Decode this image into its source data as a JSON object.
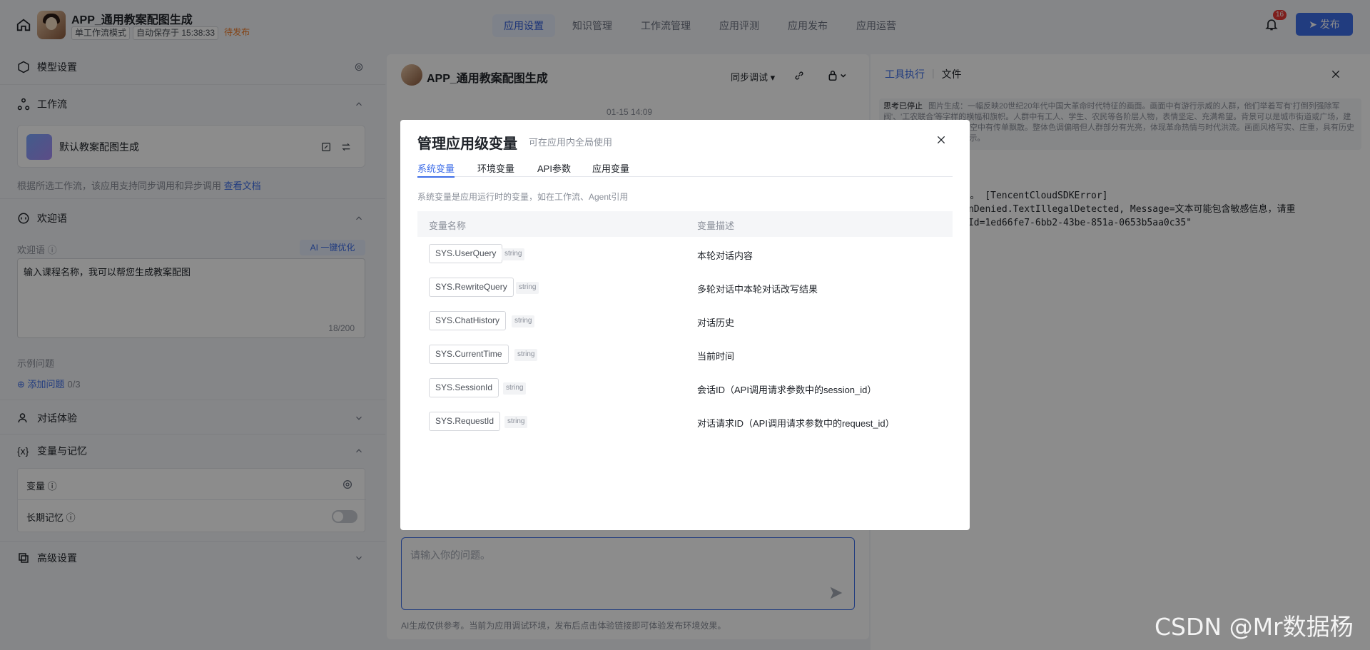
{
  "app": {
    "title": "APP_通用教案配图生成",
    "mode_tag": "单工作流模式",
    "autosave_tag": "自动保存于 15:38:33",
    "status_tag": "待发布"
  },
  "topnav": [
    "应用设置",
    "知识管理",
    "工作流管理",
    "应用评测",
    "应用发布",
    "应用运营"
  ],
  "notifications": {
    "count": "16"
  },
  "publish_label": "发布",
  "left": {
    "model_settings": "模型设置",
    "workflow": "工作流",
    "workflow_card_name": "默认教案配图生成",
    "workflow_hint": "根据所选工作流，该应用支持同步调用和异步调用",
    "workflow_hint_link": "查看文档",
    "welcome": "欢迎语",
    "welcome_field_label": "欢迎语",
    "ai_optimize": "一键优化",
    "welcome_text": "输入课程名称，我可以帮您生成教案配图",
    "welcome_count": "18/200",
    "examples_label": "示例问题",
    "add_question": "添加问题",
    "add_question_count": "0/3",
    "dialog_experience": "对话体验",
    "variables_memory": "变量与记忆",
    "variables": "变量",
    "long_memory": "长期记忆",
    "advanced": "高级设置"
  },
  "center": {
    "title": "APP_通用教案配图生成",
    "sync_debug": "同步调试",
    "date": "01-15 14:09",
    "input_placeholder": "请输入你的问题。",
    "footer": "AI生成仅供参考。当前为应用调试环境，发布后点击体验链接即可体验发布环境效果。"
  },
  "right": {
    "tab_tool": "工具执行",
    "tab_file": "文件",
    "think_label": "思考已停止",
    "think_text": "图片生成：一幅反映20世纪20年代中国大革命时代特征的画面。画面中有游行示威的人群，他们举着写有'打倒列强除军阀'、'工农联合'等字样的横幅和旗帜。人群中有工人、学生、农民等各阶层人物，表情坚定、充满希望。背景可以是城市街道或广场，建筑带有民国时期风格。天空中有传单飘散。整体色调偏暗但人群部分有光亮，体现革命热情与时代洪流。画面风格写实、庄重，具有历史厚重感，适合课堂PPT展示。",
    "code_line1": "7,",
    "code_line2": "SDK错误。 [TencentCloudSDKError]",
    "code_line3": "erationDenied.TextIllegalDetected, Message=文本可能包含敏感信息，请重",
    "code_line4": "equestId=1ed66fe7-6bb2-43be-851a-0653b5aa0c35\""
  },
  "modal": {
    "title": "管理应用级变量",
    "subtitle": "可在应用内全局使用",
    "tabs": [
      "系统变量",
      "环境变量",
      "API参数",
      "应用变量"
    ],
    "description": "系统变量是应用运行时的变量，如在工作流、Agent引用",
    "col_name": "变量名称",
    "col_desc": "变量描述",
    "rows": [
      {
        "name": "SYS.UserQuery",
        "type": "string",
        "desc": "本轮对话内容"
      },
      {
        "name": "SYS.RewriteQuery",
        "type": "string",
        "desc": "多轮对话中本轮对话改写结果"
      },
      {
        "name": "SYS.ChatHistory",
        "type": "string",
        "desc": "对话历史"
      },
      {
        "name": "SYS.CurrentTime",
        "type": "string",
        "desc": "当前时间"
      },
      {
        "name": "SYS.SessionId",
        "type": "string",
        "desc": "会话ID（API调用请求参数中的session_id）"
      },
      {
        "name": "SYS.RequestId",
        "type": "string",
        "desc": "对话请求ID（API调用请求参数中的request_id）"
      }
    ]
  },
  "watermark": "CSDN @Mr数据杨",
  "colors": {
    "accent": "#3d6de8",
    "warn": "#ee7d2b",
    "badge": "#e53935"
  },
  "icons": [
    "home-icon",
    "bell-icon",
    "send-icon",
    "close-icon",
    "gear-icon",
    "chevron-icon",
    "link-icon",
    "lock-icon",
    "edit-icon",
    "swap-icon",
    "help-icon",
    "plus-circle-icon"
  ]
}
